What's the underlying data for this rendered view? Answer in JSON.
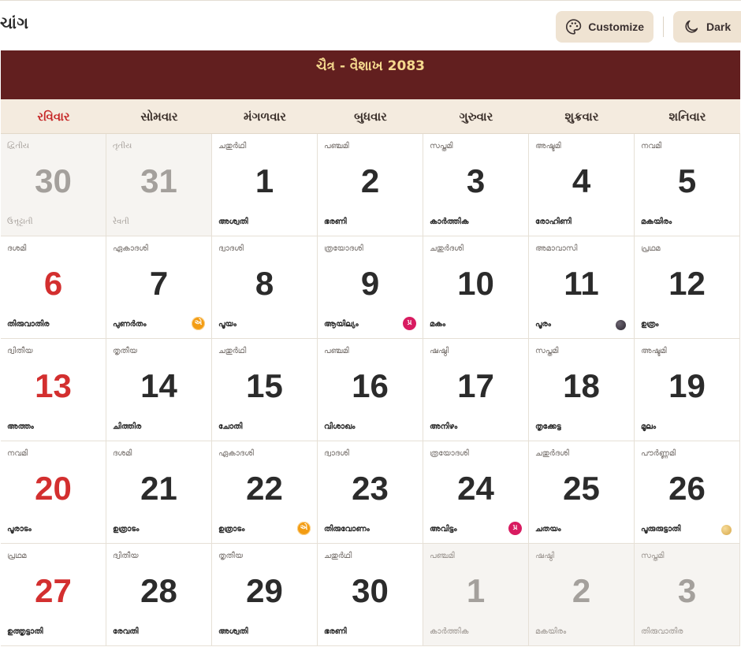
{
  "app": {
    "title_fragment": "ચાંગ"
  },
  "toolbar": {
    "customize_label": "Customize",
    "dark_label": "Dark"
  },
  "calendar": {
    "month_title": "ચૈત્ર - વૈશાખ 2083",
    "weekdays": [
      "રવિવાર",
      "સોમવાર",
      "મંગળવાર",
      "બુધવાર",
      "ગુરુવાર",
      "શુક્રવાર",
      "શનિવાર"
    ],
    "days": [
      {
        "num": "30",
        "tithi": "દ્વિતીય",
        "nak": "ઉત્તૃટ્ટાતી",
        "other": true
      },
      {
        "num": "31",
        "tithi": "તૃતીય",
        "nak": "રેવતી",
        "other": true
      },
      {
        "num": "1",
        "tithi": "ചതുർഥി",
        "nak": "അശ്വതി"
      },
      {
        "num": "2",
        "tithi": "പഞ്ചമി",
        "nak": "ഭരണി"
      },
      {
        "num": "3",
        "tithi": "സപ്തമി",
        "nak": "കാർത്തിക"
      },
      {
        "num": "4",
        "tithi": "അഷ്ടമി",
        "nak": "രോഹിണി"
      },
      {
        "num": "5",
        "tithi": "നവമി",
        "nak": "മകയിരം"
      },
      {
        "num": "6",
        "tithi": "ദശമി",
        "nak": "തിരുവാതിര"
      },
      {
        "num": "7",
        "tithi": "ഏകാദശി",
        "nak": "പുണർതം",
        "badge": "એ",
        "badge_color": "orange"
      },
      {
        "num": "8",
        "tithi": "ദ്വാദശി",
        "nak": "പൂയം"
      },
      {
        "num": "9",
        "tithi": "ത്രയോദശി",
        "nak": "ആയില്യം",
        "badge": "પ્ર",
        "badge_color": "pink"
      },
      {
        "num": "10",
        "tithi": "ചതുർദശി",
        "nak": "മകം"
      },
      {
        "num": "11",
        "tithi": "അമാവാസി",
        "nak": "പൂരം",
        "moon": "new"
      },
      {
        "num": "12",
        "tithi": "പ്രഥമ",
        "nak": "ഉത്രം"
      },
      {
        "num": "13",
        "tithi": "ദ്വിതീയ",
        "nak": "അത്തം"
      },
      {
        "num": "14",
        "tithi": "തൃതീയ",
        "nak": "ചിത്തിര"
      },
      {
        "num": "15",
        "tithi": "ചതുർഥി",
        "nak": "ചോതി"
      },
      {
        "num": "16",
        "tithi": "പഞ്ചമി",
        "nak": "വിശാഖം"
      },
      {
        "num": "17",
        "tithi": "ഷഷ്ഠി",
        "nak": "അനിഴം"
      },
      {
        "num": "18",
        "tithi": "സപ്തമി",
        "nak": "തൃക്കേട്ട"
      },
      {
        "num": "19",
        "tithi": "അഷ്ടമി",
        "nak": "മൂലം"
      },
      {
        "num": "20",
        "tithi": "നവമി",
        "nak": "പൂരാടം"
      },
      {
        "num": "21",
        "tithi": "ദശമി",
        "nak": "ഉത്രാടം"
      },
      {
        "num": "22",
        "tithi": "ഏകാദശി",
        "nak": "ഉത്രാടം",
        "badge": "એ",
        "badge_color": "orange"
      },
      {
        "num": "23",
        "tithi": "ദ്വാദശി",
        "nak": "തിരുവോണം"
      },
      {
        "num": "24",
        "tithi": "ത്രയോദശി",
        "nak": "അവിട്ടം",
        "badge": "પ્ર",
        "badge_color": "pink"
      },
      {
        "num": "25",
        "tithi": "ചതുർദശി",
        "nak": "ചതയം"
      },
      {
        "num": "26",
        "tithi": "പൗർണ്ണമി",
        "nak": "പൂരുരുട്ടാതി",
        "moon": "full"
      },
      {
        "num": "27",
        "tithi": "പ്രഥമ",
        "nak": "ഉത്തൃട്ടാതി"
      },
      {
        "num": "28",
        "tithi": "ദ്വിതീയ",
        "nak": "രേവതി"
      },
      {
        "num": "29",
        "tithi": "തൃതീയ",
        "nak": "അശ്വതി"
      },
      {
        "num": "30",
        "tithi": "ചതുർഥി",
        "nak": "ഭരണി"
      },
      {
        "num": "1",
        "tithi": "പഞ്ചമി",
        "nak": "കാർത്തിക",
        "other": true
      },
      {
        "num": "2",
        "tithi": "ഷഷ്ഠി",
        "nak": "മകയിരം",
        "other": true
      },
      {
        "num": "3",
        "tithi": "സപ്തമി",
        "nak": "തിരുവാതിര",
        "other": true
      }
    ]
  },
  "colors": {
    "header_bg": "#621f1f",
    "header_text": "#f5d98e",
    "sunday": "#d32f2f",
    "weekday_bg": "#f4ebdf"
  }
}
